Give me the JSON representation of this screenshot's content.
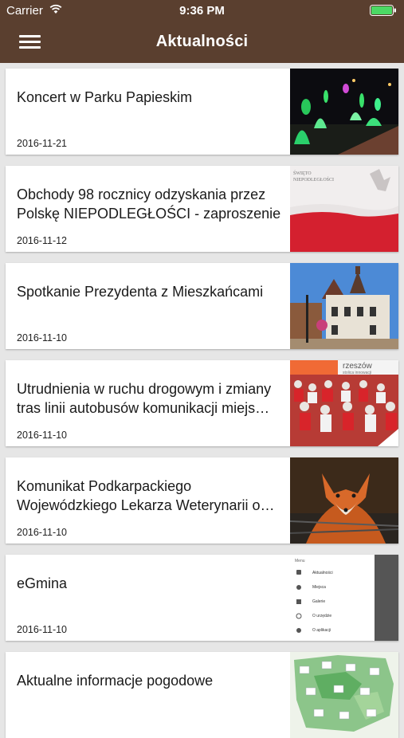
{
  "status_bar": {
    "carrier": "Carrier",
    "time": "9:36 PM"
  },
  "nav": {
    "title": "Aktualności",
    "menu_icon": "hamburger-menu-icon"
  },
  "news": [
    {
      "title": "Koncert w Parku Papieskim",
      "date": "2016-11-21",
      "thumb": "fountain-night-photo"
    },
    {
      "title": "Obchody 98 rocznicy odzyskania przez Polskę NIEPODLEGŁOŚCI - zaproszenie",
      "date": "2016-11-12",
      "thumb": "polish-flag-photo"
    },
    {
      "title": "Spotkanie Prezydenta z Mieszkańcami",
      "date": "2016-11-10",
      "thumb": "town-hall-photo"
    },
    {
      "title": "Utrudnienia w ruchu drogowym i zmiany tras linii autobusów komunikacji miejs…",
      "date": "2016-11-10",
      "thumb": "marathon-runners-photo"
    },
    {
      "title": "Komunikat Podkarpackiego Wojewódzkiego Lekarza Weterynarii o…",
      "date": "2016-11-10",
      "thumb": "fox-photo"
    },
    {
      "title": "eGmina",
      "date": "2016-11-10",
      "thumb": "app-menu-screenshot"
    },
    {
      "title": "Aktualne informacje pogodowe",
      "date": "",
      "thumb": "weather-map-photo"
    }
  ],
  "thumbs_text": {
    "flag_caption_1": "ŚWIĘTO",
    "flag_caption_2": "NIEPODLEGŁOŚCI",
    "banner_main": "rzeszów",
    "banner_sub": "stolica innowacji",
    "menu_header": "Menu",
    "menu_items": [
      "Aktualności",
      "Miejsca",
      "Galerie",
      "O urzędzie",
      "O aplikacji"
    ]
  },
  "colors": {
    "bar": "#5a3f2f",
    "battery": "#4cd964",
    "background": "#e6e6e6"
  }
}
